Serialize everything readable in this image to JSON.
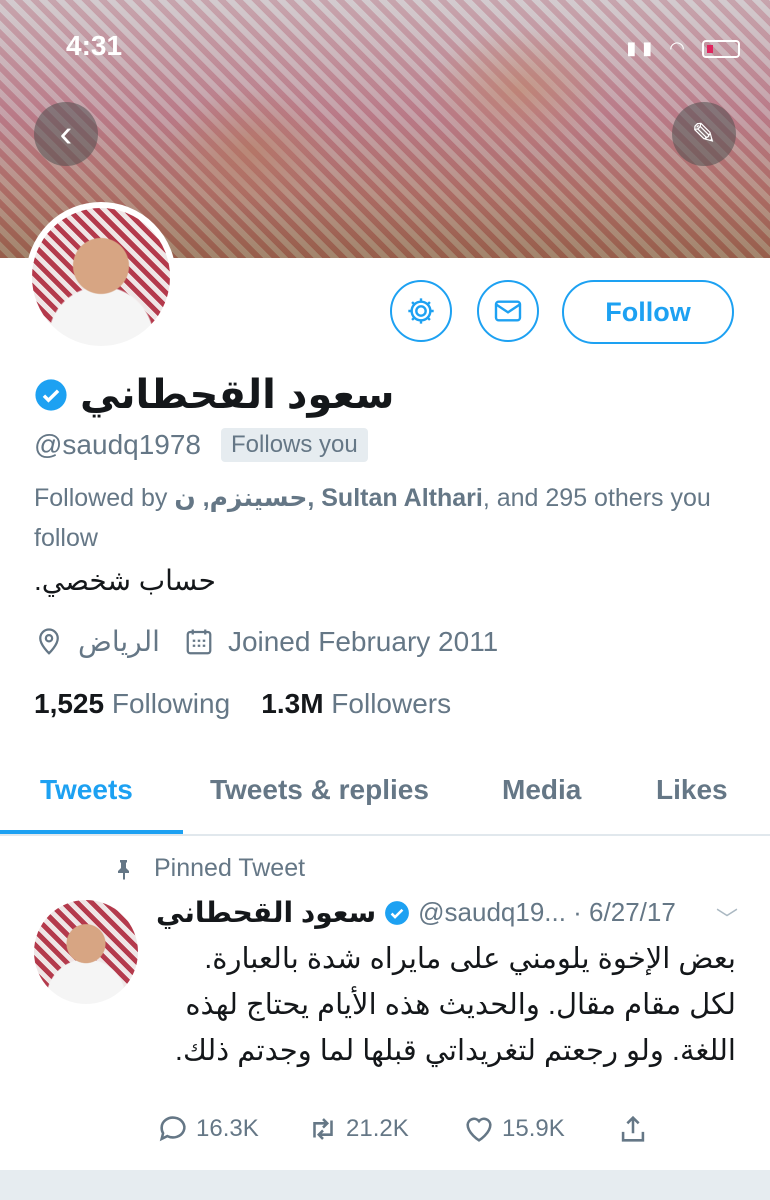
{
  "status_bar": {
    "time": "4:31"
  },
  "profile": {
    "display_name": "سعود القحطاني",
    "handle": "@saudq1978",
    "follows_you": "Follows you",
    "followed_by_prefix": "Followed by",
    "followed_by_names": "حسينزم, ن",
    "followed_by_bold": "Sultan Althari",
    "followed_by_suffix": ", and 295 others you follow",
    "bio": "حساب شخصي.",
    "location": "الرياض",
    "joined": "Joined February 2011",
    "following_count": "1,525",
    "following_label": "Following",
    "followers_count": "1.3M",
    "followers_label": "Followers"
  },
  "actions": {
    "follow_label": "Follow"
  },
  "tabs": [
    {
      "label": "Tweets"
    },
    {
      "label": "Tweets & replies"
    },
    {
      "label": "Media"
    },
    {
      "label": "Likes"
    }
  ],
  "tweet": {
    "pinned_label": "Pinned Tweet",
    "name": "سعود القحطاني",
    "handle_date": "@saudq19... · 6/27/17",
    "text": "بعض الإخوة يلومني على مايراه شدة بالعبارة.\nلكل مقام مقال. والحديث هذه الأيام يحتاج لهذه اللغة. ولو رجعتم لتغريداتي قبلها لما وجدتم ذلك.",
    "replies": "16.3K",
    "retweets": "21.2K",
    "likes": "15.9K"
  },
  "colors": {
    "accent": "#1da1f2",
    "secondary_text": "#657786"
  }
}
